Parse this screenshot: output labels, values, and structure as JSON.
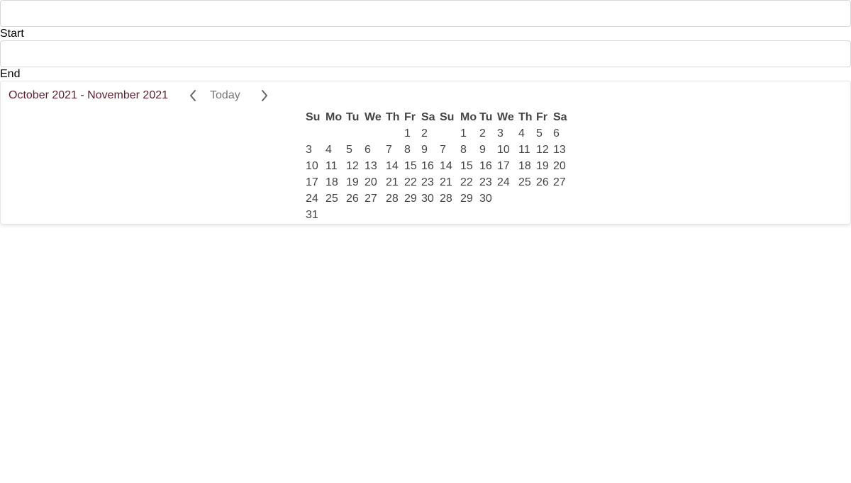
{
  "start_field": {
    "value": "",
    "label": "Start"
  },
  "end_field": {
    "value": "",
    "label": "End"
  },
  "calendar": {
    "range_title": "October 2021 - November 2021",
    "today_label": "Today",
    "weekdays": [
      "Su",
      "Mo",
      "Tu",
      "We",
      "Th",
      "Fr",
      "Sa"
    ],
    "months": [
      {
        "weeks": [
          [
            "",
            "",
            "",
            "",
            "",
            "1",
            "2"
          ],
          [
            "3",
            "4",
            "5",
            "6",
            "7",
            "8",
            "9"
          ],
          [
            "10",
            "11",
            "12",
            "13",
            "14",
            "15",
            "16"
          ],
          [
            "17",
            "18",
            "19",
            "20",
            "21",
            "22",
            "23"
          ],
          [
            "24",
            "25",
            "26",
            "27",
            "28",
            "29",
            "30"
          ],
          [
            "31",
            "",
            "",
            "",
            "",
            "",
            ""
          ]
        ]
      },
      {
        "weeks": [
          [
            "",
            "1",
            "2",
            "3",
            "4",
            "5",
            "6"
          ],
          [
            "7",
            "8",
            "9",
            "10",
            "11",
            "12",
            "13"
          ],
          [
            "14",
            "15",
            "16",
            "17",
            "18",
            "19",
            "20"
          ],
          [
            "21",
            "22",
            "23",
            "24",
            "25",
            "26",
            "27"
          ],
          [
            "28",
            "29",
            "30",
            "",
            "",
            "",
            ""
          ],
          [
            "",
            "",
            "",
            "",
            "",
            "",
            ""
          ]
        ]
      }
    ]
  },
  "colors": {
    "title": "#5a1f2a",
    "today": "#757575",
    "day_text": "#444444",
    "chevron": "#666666"
  }
}
